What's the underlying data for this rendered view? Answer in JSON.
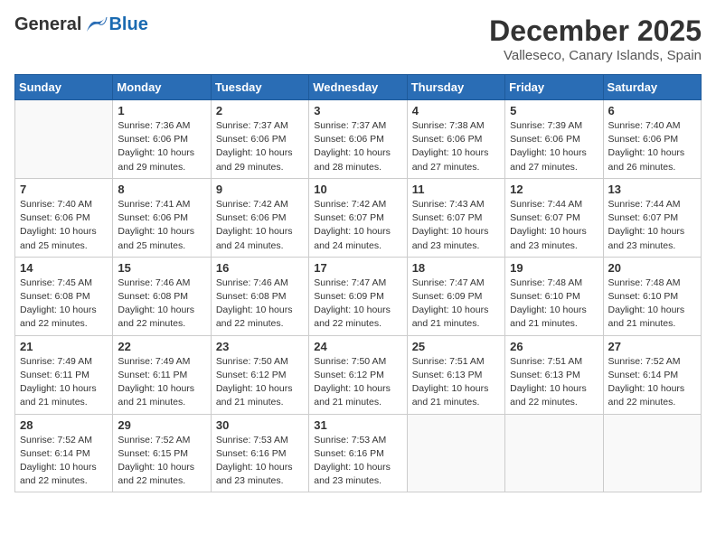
{
  "header": {
    "logo": {
      "general": "General",
      "blue": "Blue"
    },
    "title": "December 2025",
    "subtitle": "Valleseco, Canary Islands, Spain"
  },
  "weekdays": [
    "Sunday",
    "Monday",
    "Tuesday",
    "Wednesday",
    "Thursday",
    "Friday",
    "Saturday"
  ],
  "weeks": [
    [
      {
        "day": null,
        "info": null
      },
      {
        "day": "1",
        "info": "Sunrise: 7:36 AM\nSunset: 6:06 PM\nDaylight: 10 hours\nand 29 minutes."
      },
      {
        "day": "2",
        "info": "Sunrise: 7:37 AM\nSunset: 6:06 PM\nDaylight: 10 hours\nand 29 minutes."
      },
      {
        "day": "3",
        "info": "Sunrise: 7:37 AM\nSunset: 6:06 PM\nDaylight: 10 hours\nand 28 minutes."
      },
      {
        "day": "4",
        "info": "Sunrise: 7:38 AM\nSunset: 6:06 PM\nDaylight: 10 hours\nand 27 minutes."
      },
      {
        "day": "5",
        "info": "Sunrise: 7:39 AM\nSunset: 6:06 PM\nDaylight: 10 hours\nand 27 minutes."
      },
      {
        "day": "6",
        "info": "Sunrise: 7:40 AM\nSunset: 6:06 PM\nDaylight: 10 hours\nand 26 minutes."
      }
    ],
    [
      {
        "day": "7",
        "info": "Sunrise: 7:40 AM\nSunset: 6:06 PM\nDaylight: 10 hours\nand 25 minutes."
      },
      {
        "day": "8",
        "info": "Sunrise: 7:41 AM\nSunset: 6:06 PM\nDaylight: 10 hours\nand 25 minutes."
      },
      {
        "day": "9",
        "info": "Sunrise: 7:42 AM\nSunset: 6:06 PM\nDaylight: 10 hours\nand 24 minutes."
      },
      {
        "day": "10",
        "info": "Sunrise: 7:42 AM\nSunset: 6:07 PM\nDaylight: 10 hours\nand 24 minutes."
      },
      {
        "day": "11",
        "info": "Sunrise: 7:43 AM\nSunset: 6:07 PM\nDaylight: 10 hours\nand 23 minutes."
      },
      {
        "day": "12",
        "info": "Sunrise: 7:44 AM\nSunset: 6:07 PM\nDaylight: 10 hours\nand 23 minutes."
      },
      {
        "day": "13",
        "info": "Sunrise: 7:44 AM\nSunset: 6:07 PM\nDaylight: 10 hours\nand 23 minutes."
      }
    ],
    [
      {
        "day": "14",
        "info": "Sunrise: 7:45 AM\nSunset: 6:08 PM\nDaylight: 10 hours\nand 22 minutes."
      },
      {
        "day": "15",
        "info": "Sunrise: 7:46 AM\nSunset: 6:08 PM\nDaylight: 10 hours\nand 22 minutes."
      },
      {
        "day": "16",
        "info": "Sunrise: 7:46 AM\nSunset: 6:08 PM\nDaylight: 10 hours\nand 22 minutes."
      },
      {
        "day": "17",
        "info": "Sunrise: 7:47 AM\nSunset: 6:09 PM\nDaylight: 10 hours\nand 22 minutes."
      },
      {
        "day": "18",
        "info": "Sunrise: 7:47 AM\nSunset: 6:09 PM\nDaylight: 10 hours\nand 21 minutes."
      },
      {
        "day": "19",
        "info": "Sunrise: 7:48 AM\nSunset: 6:10 PM\nDaylight: 10 hours\nand 21 minutes."
      },
      {
        "day": "20",
        "info": "Sunrise: 7:48 AM\nSunset: 6:10 PM\nDaylight: 10 hours\nand 21 minutes."
      }
    ],
    [
      {
        "day": "21",
        "info": "Sunrise: 7:49 AM\nSunset: 6:11 PM\nDaylight: 10 hours\nand 21 minutes."
      },
      {
        "day": "22",
        "info": "Sunrise: 7:49 AM\nSunset: 6:11 PM\nDaylight: 10 hours\nand 21 minutes."
      },
      {
        "day": "23",
        "info": "Sunrise: 7:50 AM\nSunset: 6:12 PM\nDaylight: 10 hours\nand 21 minutes."
      },
      {
        "day": "24",
        "info": "Sunrise: 7:50 AM\nSunset: 6:12 PM\nDaylight: 10 hours\nand 21 minutes."
      },
      {
        "day": "25",
        "info": "Sunrise: 7:51 AM\nSunset: 6:13 PM\nDaylight: 10 hours\nand 21 minutes."
      },
      {
        "day": "26",
        "info": "Sunrise: 7:51 AM\nSunset: 6:13 PM\nDaylight: 10 hours\nand 22 minutes."
      },
      {
        "day": "27",
        "info": "Sunrise: 7:52 AM\nSunset: 6:14 PM\nDaylight: 10 hours\nand 22 minutes."
      }
    ],
    [
      {
        "day": "28",
        "info": "Sunrise: 7:52 AM\nSunset: 6:14 PM\nDaylight: 10 hours\nand 22 minutes."
      },
      {
        "day": "29",
        "info": "Sunrise: 7:52 AM\nSunset: 6:15 PM\nDaylight: 10 hours\nand 22 minutes."
      },
      {
        "day": "30",
        "info": "Sunrise: 7:53 AM\nSunset: 6:16 PM\nDaylight: 10 hours\nand 23 minutes."
      },
      {
        "day": "31",
        "info": "Sunrise: 7:53 AM\nSunset: 6:16 PM\nDaylight: 10 hours\nand 23 minutes."
      },
      {
        "day": null,
        "info": null
      },
      {
        "day": null,
        "info": null
      },
      {
        "day": null,
        "info": null
      }
    ]
  ]
}
